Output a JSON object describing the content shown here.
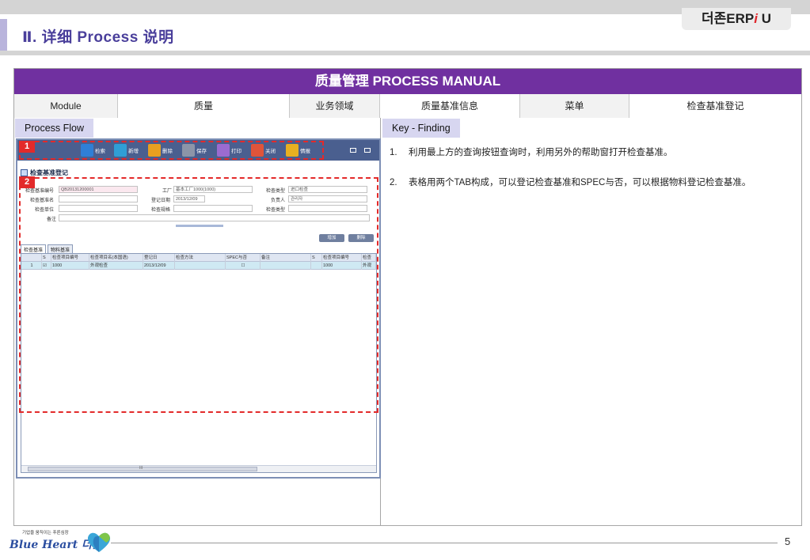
{
  "header": {
    "brand": "더존ERP",
    "brand_slash": "i",
    "brand_suffix": " U",
    "section_title": "Ⅱ. 详细 Process 说明"
  },
  "manual": {
    "title": "质量管理 PROCESS MANUAL",
    "meta": [
      {
        "key": "Module",
        "value": "质量"
      },
      {
        "key": "业务领域",
        "value": "质量基准信息"
      },
      {
        "key": "菜单",
        "value": "检查基准登记"
      }
    ],
    "process_flow_label": "Process Flow",
    "key_finding_label": "Key - Finding"
  },
  "screenshot": {
    "toolbar": [
      {
        "icon": "search-icon",
        "label": "检索",
        "color": "#2f7fd6"
      },
      {
        "icon": "add-icon",
        "label": "新增",
        "color": "#2f9fd6"
      },
      {
        "icon": "delete-icon",
        "label": "删除",
        "color": "#e8a020"
      },
      {
        "icon": "save-icon",
        "label": "保存",
        "color": "#8c95a8"
      },
      {
        "icon": "print-icon",
        "label": "打印",
        "color": "#9b6bd0"
      },
      {
        "icon": "close-icon",
        "label": "关闭",
        "color": "#e0543a"
      },
      {
        "icon": "info-icon",
        "label": "情报",
        "color": "#e8b020"
      }
    ],
    "form_title": "检查基准登记",
    "fields": {
      "code_label": "检查基准编号",
      "code_value": "QB20131200001",
      "name_label": "检查基准名",
      "unit_label": "检查单位",
      "remark_label": "备注",
      "plant_label": "工厂",
      "plant_value": "基本工厂1000(1000)",
      "date_label": "登记日期",
      "date_value": "2013/12/09",
      "spec_label": "检查规格",
      "type_label": "检查类型",
      "type_value": "进口检查",
      "owner_label": "负责人",
      "owner_value": "관리자",
      "type2_label": "检查类型"
    },
    "buttons": {
      "add": "增加",
      "delete": "删除"
    },
    "tabs": [
      "检查基准",
      "物料基准"
    ],
    "grid_headers": [
      "S",
      "检查项目编号",
      "检查项目名(本国语)",
      "登记日",
      "检查方法",
      "SPEC与否",
      "备注",
      "S",
      "检查项目编号",
      "检查"
    ],
    "grid_row": {
      "index": "1",
      "code": "1000",
      "name": "外观检查",
      "date": "2013/12/09",
      "code2": "1000",
      "name2": "外观"
    },
    "scroll_mark": "III",
    "badges": [
      "1",
      "2"
    ]
  },
  "findings": [
    {
      "num": "1.",
      "text": "利用最上方的查询按钮查询时，利用另外的帮助窗打开检查基准。"
    },
    {
      "num": "2.",
      "text": "表格用两个TAB构成，可以登记检查基准和SPEC与否，可以根据物料登记检查基准。"
    }
  ],
  "footer": {
    "logo_tagline": "기업을 움직이는 푸른심장",
    "logo_text": "Blue Heart 더존",
    "page_number": "5"
  }
}
